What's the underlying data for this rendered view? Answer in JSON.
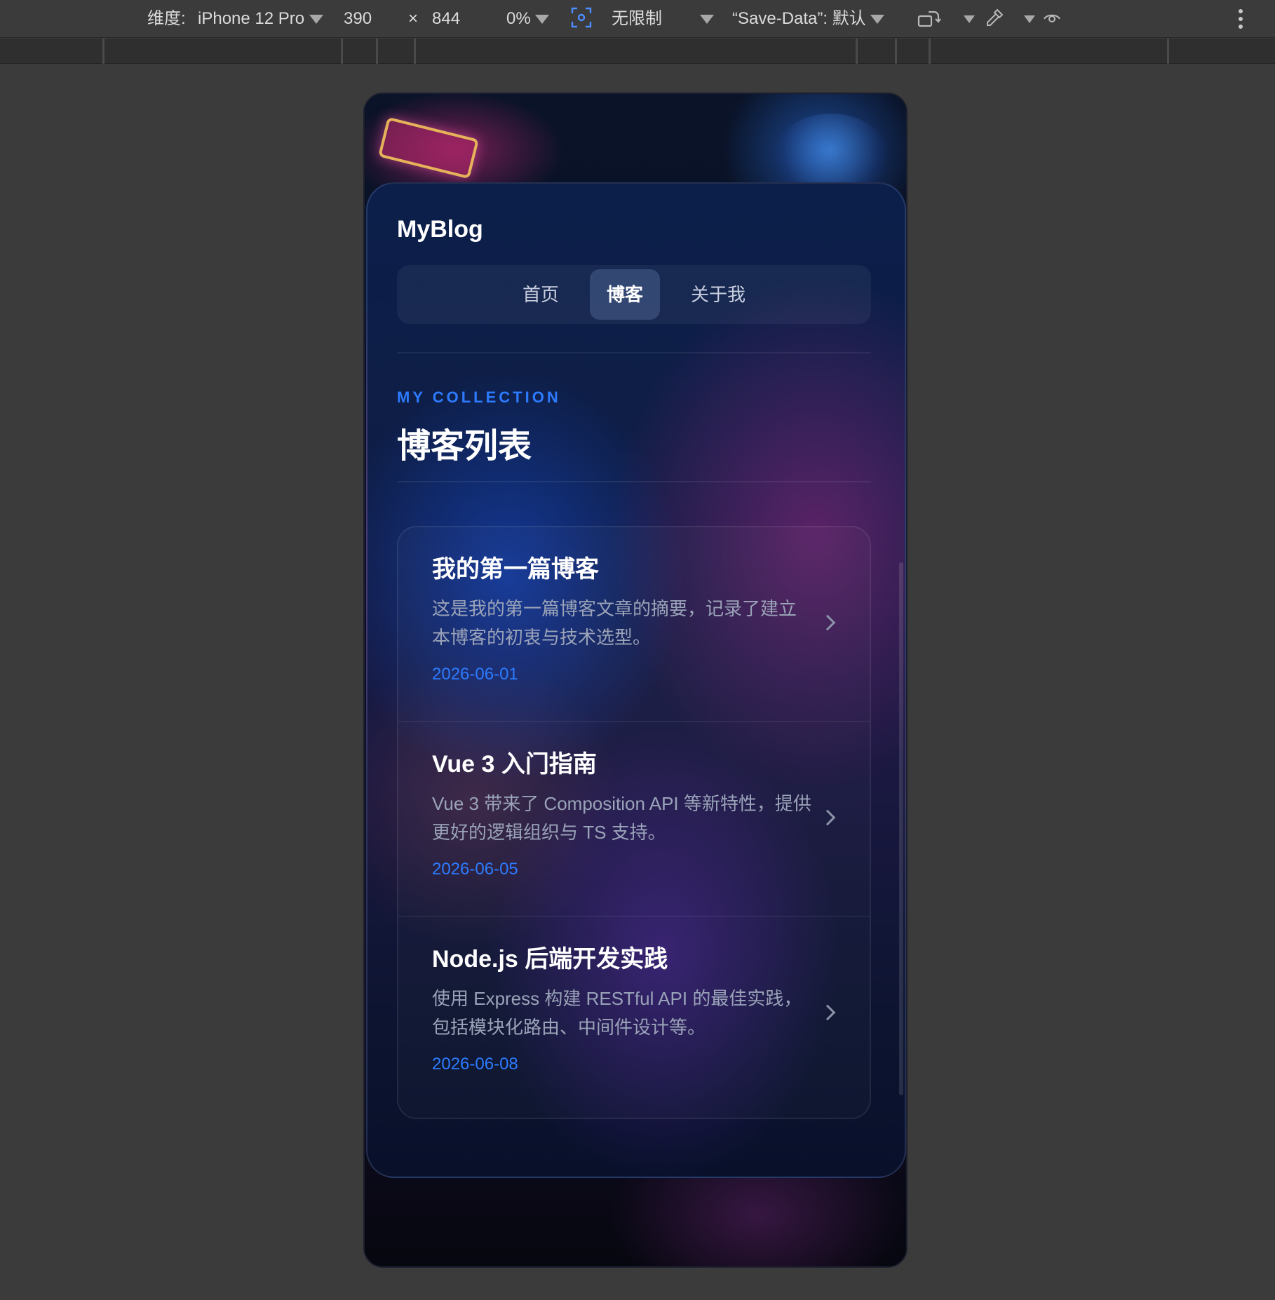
{
  "devtools": {
    "dimensions_label": "维度:",
    "device": "iPhone 12 Pro",
    "width": "390",
    "times": "×",
    "height": "844",
    "zoom": "0%",
    "throttle": "无限制",
    "save_data": "“Save-Data”: 默认"
  },
  "site": {
    "brand": "MyBlog",
    "tabs": [
      {
        "label": "首页",
        "active": false
      },
      {
        "label": "博客",
        "active": true
      },
      {
        "label": "关于我",
        "active": false
      }
    ]
  },
  "page": {
    "eyebrow": "MY COLLECTION",
    "title": "博客列表"
  },
  "posts": [
    {
      "title": "我的第一篇博客",
      "summary": "这是我的第一篇博客文章的摘要，记录了建立本博客的初衷与技术选型。",
      "date": "2026-06-01"
    },
    {
      "title": "Vue 3 入门指南",
      "summary": "Vue 3 带来了 Composition API 等新特性，提供更好的逻辑组织与 TS 支持。",
      "date": "2026-06-05"
    },
    {
      "title": "Node.js 后端开发实践",
      "summary": "使用 Express 构建 RESTful API 的最佳实践，包括模块化路由、中间件设计等。",
      "date": "2026-06-08"
    }
  ],
  "colors": {
    "accent": "#2d7bff",
    "active_tab": "#4b6a9a"
  }
}
